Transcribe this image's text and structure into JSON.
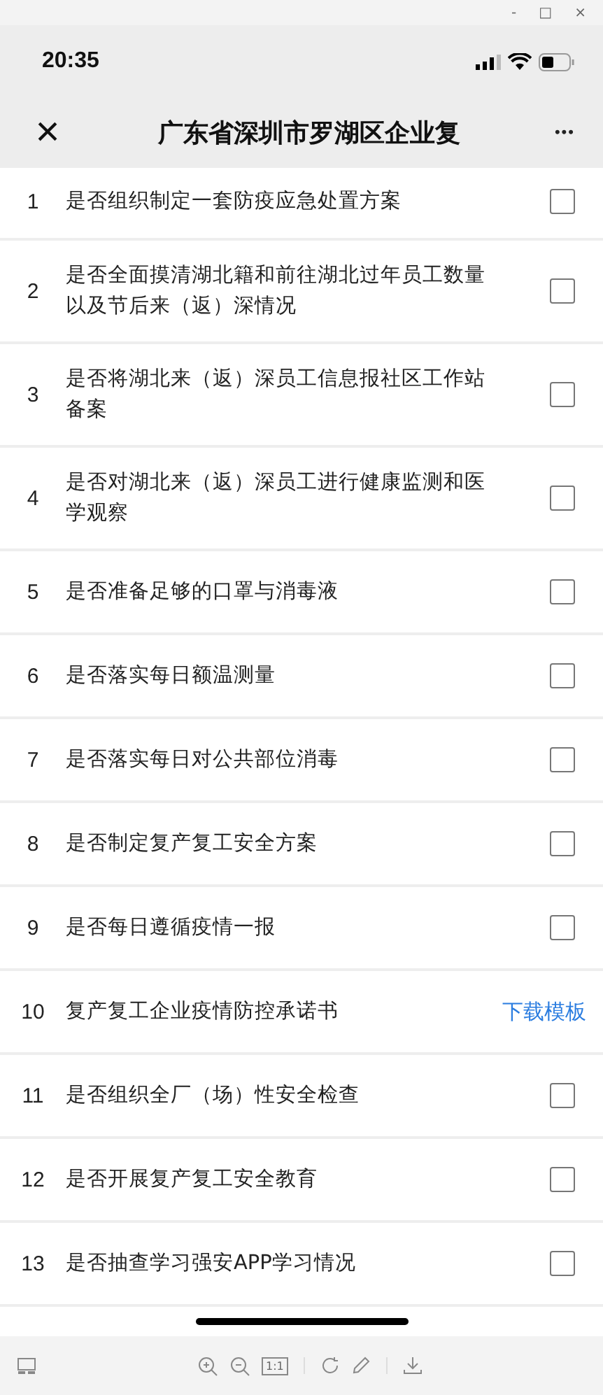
{
  "window": {
    "controls": [
      "-",
      "□",
      "×"
    ]
  },
  "status_bar": {
    "time": "20:35"
  },
  "nav": {
    "close": "×",
    "title": "广东省深圳市罗湖区企业复",
    "more": "•••"
  },
  "items": [
    {
      "number": "1",
      "text": "是否组织制定一套防疫应急处置方案",
      "kind": "checkbox",
      "checked": false
    },
    {
      "number": "2",
      "text": "是否全面摸清湖北籍和前往湖北过年员工数量以及节后来（返）深情况",
      "kind": "checkbox",
      "checked": false
    },
    {
      "number": "3",
      "text": "是否将湖北来（返）深员工信息报社区工作站备案",
      "kind": "checkbox",
      "checked": false
    },
    {
      "number": "4",
      "text": "是否对湖北来（返）深员工进行健康监测和医学观察",
      "kind": "checkbox",
      "checked": false
    },
    {
      "number": "5",
      "text": "是否准备足够的口罩与消毒液",
      "kind": "checkbox",
      "checked": false
    },
    {
      "number": "6",
      "text": "是否落实每日额温测量",
      "kind": "checkbox",
      "checked": false
    },
    {
      "number": "7",
      "text": "是否落实每日对公共部位消毒",
      "kind": "checkbox",
      "checked": false
    },
    {
      "number": "8",
      "text": "是否制定复产复工安全方案",
      "kind": "checkbox",
      "checked": false
    },
    {
      "number": "9",
      "text": "是否每日遵循疫情一报",
      "kind": "checkbox",
      "checked": false
    },
    {
      "number": "10",
      "text": "复产复工企业疫情防控承诺书",
      "kind": "link",
      "link": "下载模板"
    },
    {
      "number": "11",
      "text": "是否组织全厂（场）性安全检查",
      "kind": "checkbox",
      "checked": false
    },
    {
      "number": "12",
      "text": "是否开展复产复工安全教育",
      "kind": "checkbox",
      "checked": false
    },
    {
      "number": "13",
      "text": "是否抽查学习强安APP学习情况",
      "kind": "checkbox",
      "checked": false
    }
  ],
  "toolbar": {
    "zoom_reset": "1:1"
  }
}
